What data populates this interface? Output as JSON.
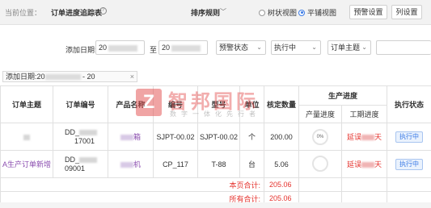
{
  "topbar": {
    "crumb_label": "当前位置：",
    "crumb_title": "订单进度追踪表",
    "help_icon": "?",
    "sort_label": "排序规则",
    "radio_tree": "树状视图",
    "radio_flat": "平铺视图",
    "btn_warn": "预警设置",
    "btn_cols": "列设置"
  },
  "filter": {
    "date_label": "添加日期:",
    "date_from": "20",
    "date_to_label": "至",
    "date_to": "20",
    "warn_status": "预警状态",
    "exec_status": "执行中",
    "theme": "订单主题"
  },
  "tag": {
    "text_prefix": "添加日期:20",
    "text_mid": " - 20",
    "close": "×"
  },
  "table": {
    "headers": {
      "theme": "订单主题",
      "code": "订单编号",
      "product": "产品名称",
      "num": "编号",
      "model": "型号",
      "unit": "单位",
      "qty": "核定数量",
      "progress": "生产进度",
      "prod_progress": "产量进度",
      "time_progress": "工期进度",
      "exec": "执行状态"
    },
    "rows": [
      {
        "theme": "",
        "code_prefix": "DD_",
        "code_suffix": "17001",
        "product": "箱",
        "num": "SJPT-00.02",
        "model": "SJPT-00.02",
        "unit": "个",
        "qty": "200.00",
        "prod_progress": "0%",
        "delay_label": "延误",
        "delay_unit": "天",
        "exec": "执行中"
      },
      {
        "theme": "A生产订单新增",
        "code_prefix": "DD_",
        "code_suffix": "09001",
        "product": "机",
        "num": "CP_117",
        "model": "T-88",
        "unit": "台",
        "qty": "5.06",
        "prod_progress": "0%",
        "delay_label": "延误",
        "delay_unit": "天",
        "exec": "执行中"
      }
    ],
    "page_total_label": "本页合计:",
    "page_total": "205.06",
    "all_total_label": "所有合计:",
    "all_total": "205.06"
  },
  "watermark": {
    "logo": "Z",
    "title": "智邦国际",
    "sub": "数字一体化先行者"
  },
  "colors": {
    "accent": "#3b7be6",
    "alert": "#e5322d",
    "link": "#8a4caf"
  }
}
